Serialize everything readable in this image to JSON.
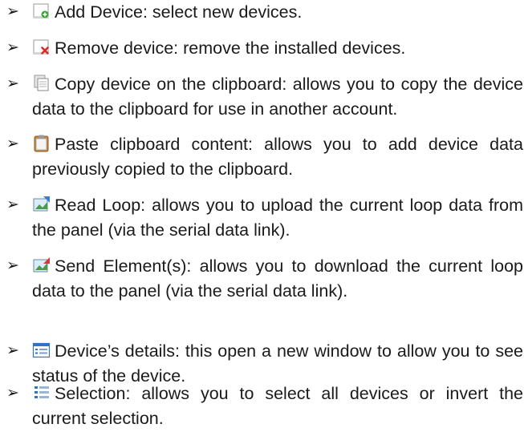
{
  "bullet_glyph": "➢",
  "items": [
    {
      "icon": "add-device-icon",
      "text": "Add Device: select new devices."
    },
    {
      "icon": "remove-device-icon",
      "text": "Remove device: remove the installed devices."
    },
    {
      "icon": "copy-icon",
      "text": "Copy device on the clipboard: allows you to copy the device data to the clipboard for use in another account."
    },
    {
      "icon": "paste-icon",
      "text": "Paste clipboard content: allows you to add device data previously copied to the clipboard."
    },
    {
      "icon": "read-loop-icon",
      "text": "Read Loop: allows you to upload the current loop data from the panel (via the serial data link)."
    },
    {
      "icon": "send-element-icon",
      "text": "Send Element(s): allows you to download the current loop data to the panel (via the serial data link)."
    },
    {
      "icon": "device-details-icon",
      "text": "Device’s details: this open a new window to allow you to see status of the device."
    },
    {
      "icon": "selection-icon",
      "text": "Selection: allows you to select all devices or invert the current selection."
    }
  ]
}
